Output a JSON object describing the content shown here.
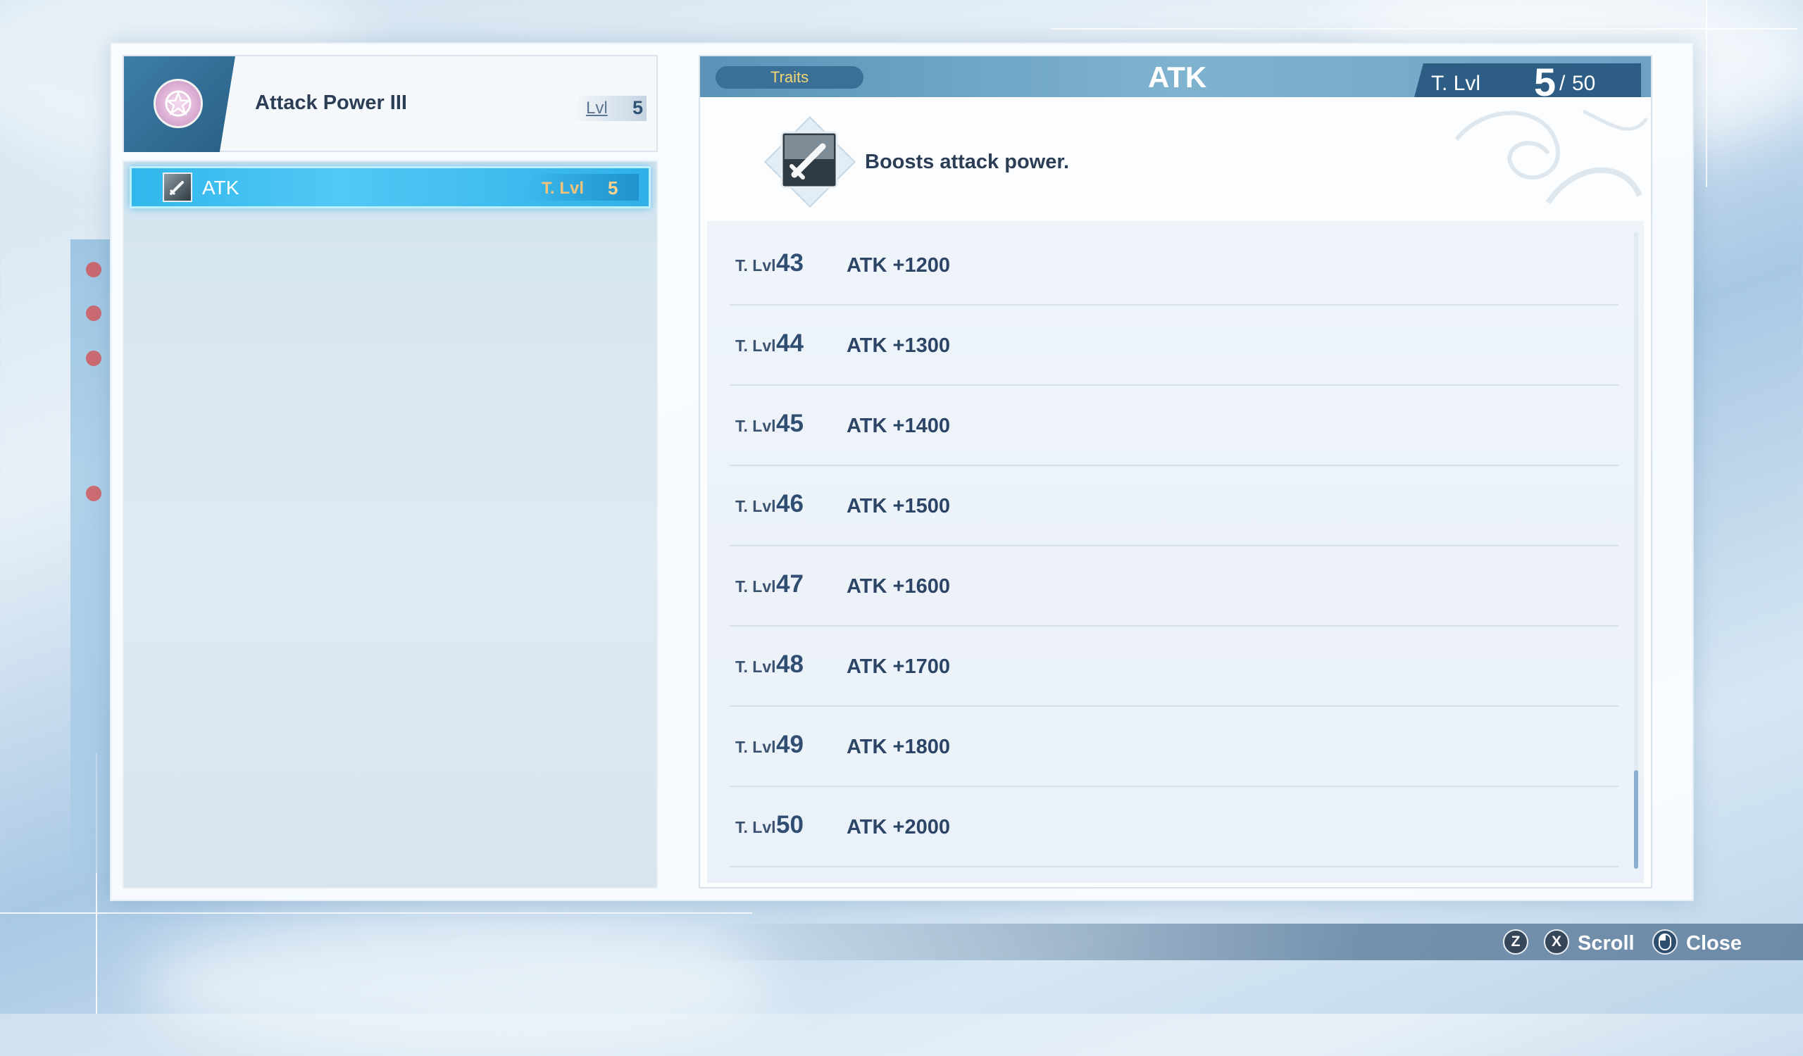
{
  "trait": {
    "name": "Attack Power III",
    "level_label": "Lvl",
    "level": "5"
  },
  "left_list": [
    {
      "label": "ATK",
      "tlvl_label": "T. Lvl",
      "tlvl": "5",
      "icon": "sword-icon"
    }
  ],
  "detail": {
    "tab": "Traits",
    "title": "ATK",
    "tlvl_label": "T. Lvl",
    "tlvl_current": "5",
    "tlvl_separator": "/",
    "tlvl_max": "50",
    "description": "Boosts attack power.",
    "icon": "sword-icon",
    "levels": [
      {
        "label": "T. Lvl",
        "num": "43",
        "effect": "ATK +1200"
      },
      {
        "label": "T. Lvl",
        "num": "44",
        "effect": "ATK +1300"
      },
      {
        "label": "T. Lvl",
        "num": "45",
        "effect": "ATK +1400"
      },
      {
        "label": "T. Lvl",
        "num": "46",
        "effect": "ATK +1500"
      },
      {
        "label": "T. Lvl",
        "num": "47",
        "effect": "ATK +1600"
      },
      {
        "label": "T. Lvl",
        "num": "48",
        "effect": "ATK +1700"
      },
      {
        "label": "T. Lvl",
        "num": "49",
        "effect": "ATK +1800"
      },
      {
        "label": "T. Lvl",
        "num": "50",
        "effect": "ATK +2000"
      }
    ]
  },
  "controls": {
    "z_key": "Z",
    "x_key": "X",
    "scroll_label": "Scroll",
    "close_label": "Close"
  },
  "colors": {
    "accent": "#31b7ec",
    "header_bar": "#5b93b8",
    "tab_text": "#f2d772",
    "tlvl_highlight": "#ffd38e"
  }
}
